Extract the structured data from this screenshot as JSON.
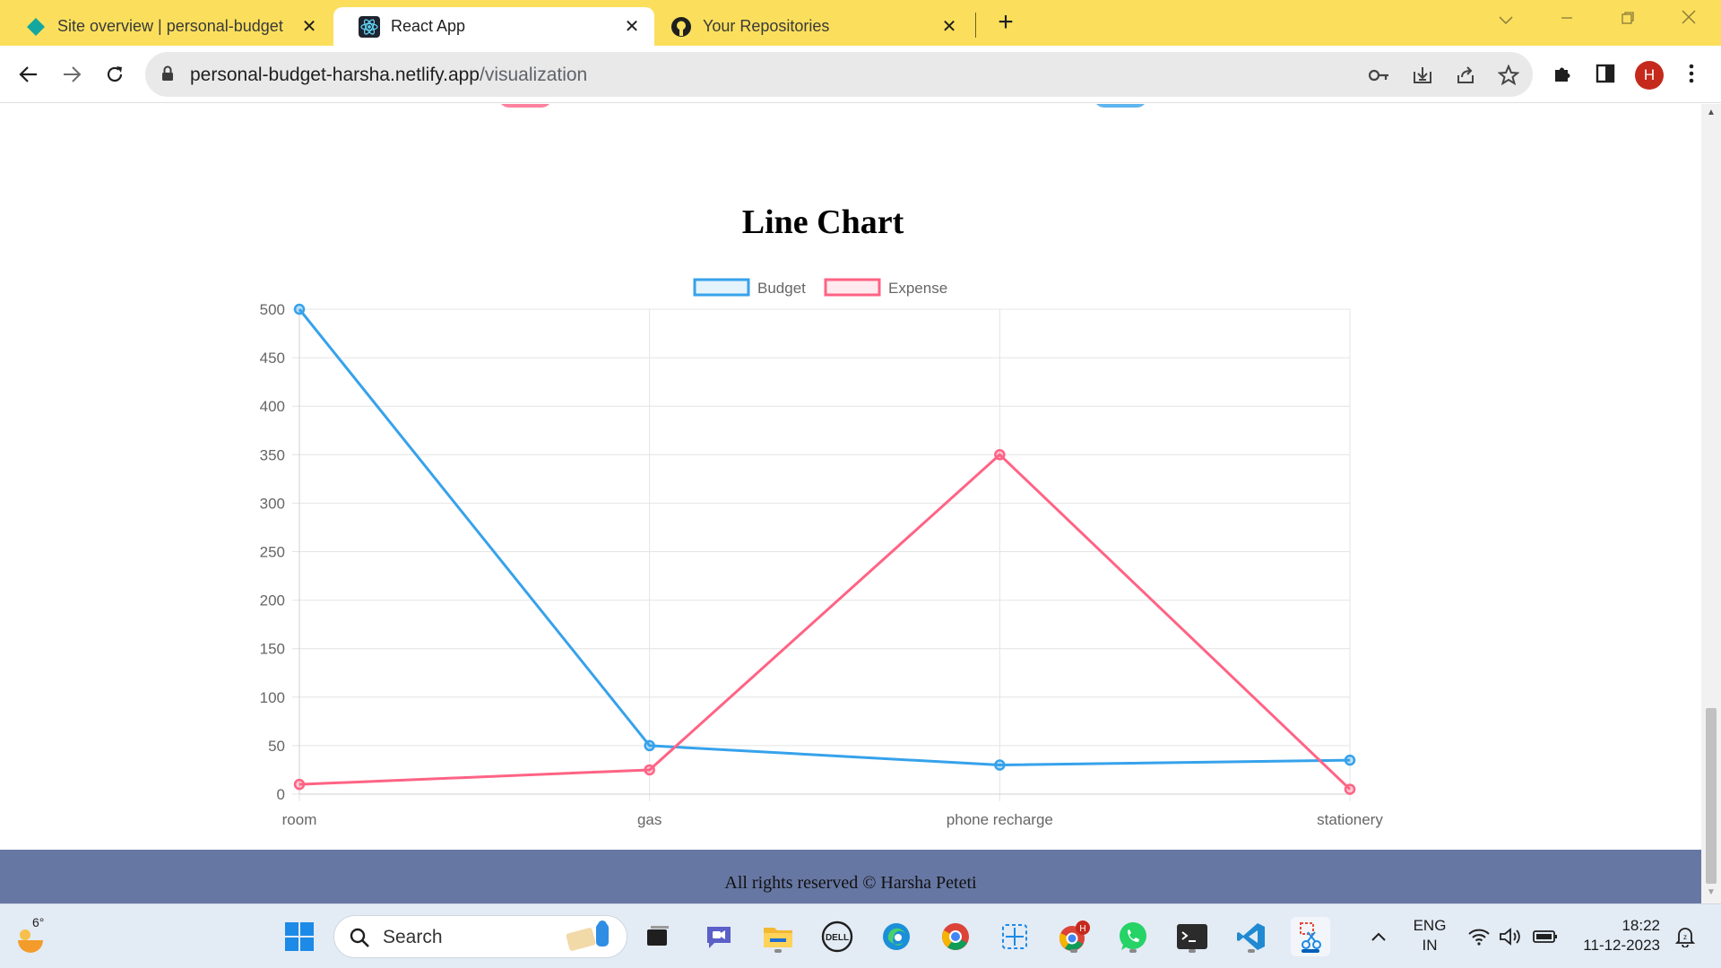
{
  "browser": {
    "tabs": [
      {
        "title": "Site overview | personal-budget",
        "icon": "netlify-icon",
        "active": false
      },
      {
        "title": "React App",
        "icon": "react-icon",
        "active": true
      },
      {
        "title": "Your Repositories",
        "icon": "github-icon",
        "active": false
      }
    ],
    "url_domain": "personal-budget-harsha.netlify.app",
    "url_path": "/visualization",
    "profile_initial": "H"
  },
  "page": {
    "chart_heading": "Line Chart",
    "footer_text": "All rights reserved © Harsha Peteti"
  },
  "chart_data": {
    "type": "line",
    "title": "Line Chart",
    "categories": [
      "room",
      "gas",
      "phone recharge",
      "stationery"
    ],
    "series": [
      {
        "name": "Budget",
        "values": [
          500,
          50,
          30,
          35
        ],
        "color": "#36a2eb"
      },
      {
        "name": "Expense",
        "values": [
          10,
          25,
          350,
          5
        ],
        "color": "#ff6384"
      }
    ],
    "ylim": [
      0,
      500
    ],
    "yticks": [
      0,
      50,
      100,
      150,
      200,
      250,
      300,
      350,
      400,
      450,
      500
    ],
    "grid": true,
    "legend": "top-center"
  },
  "taskbar": {
    "weather_temp": "6°",
    "search_label": "Search",
    "language_line1": "ENG",
    "language_line2": "IN",
    "time": "18:22",
    "date": "11-12-2023"
  }
}
